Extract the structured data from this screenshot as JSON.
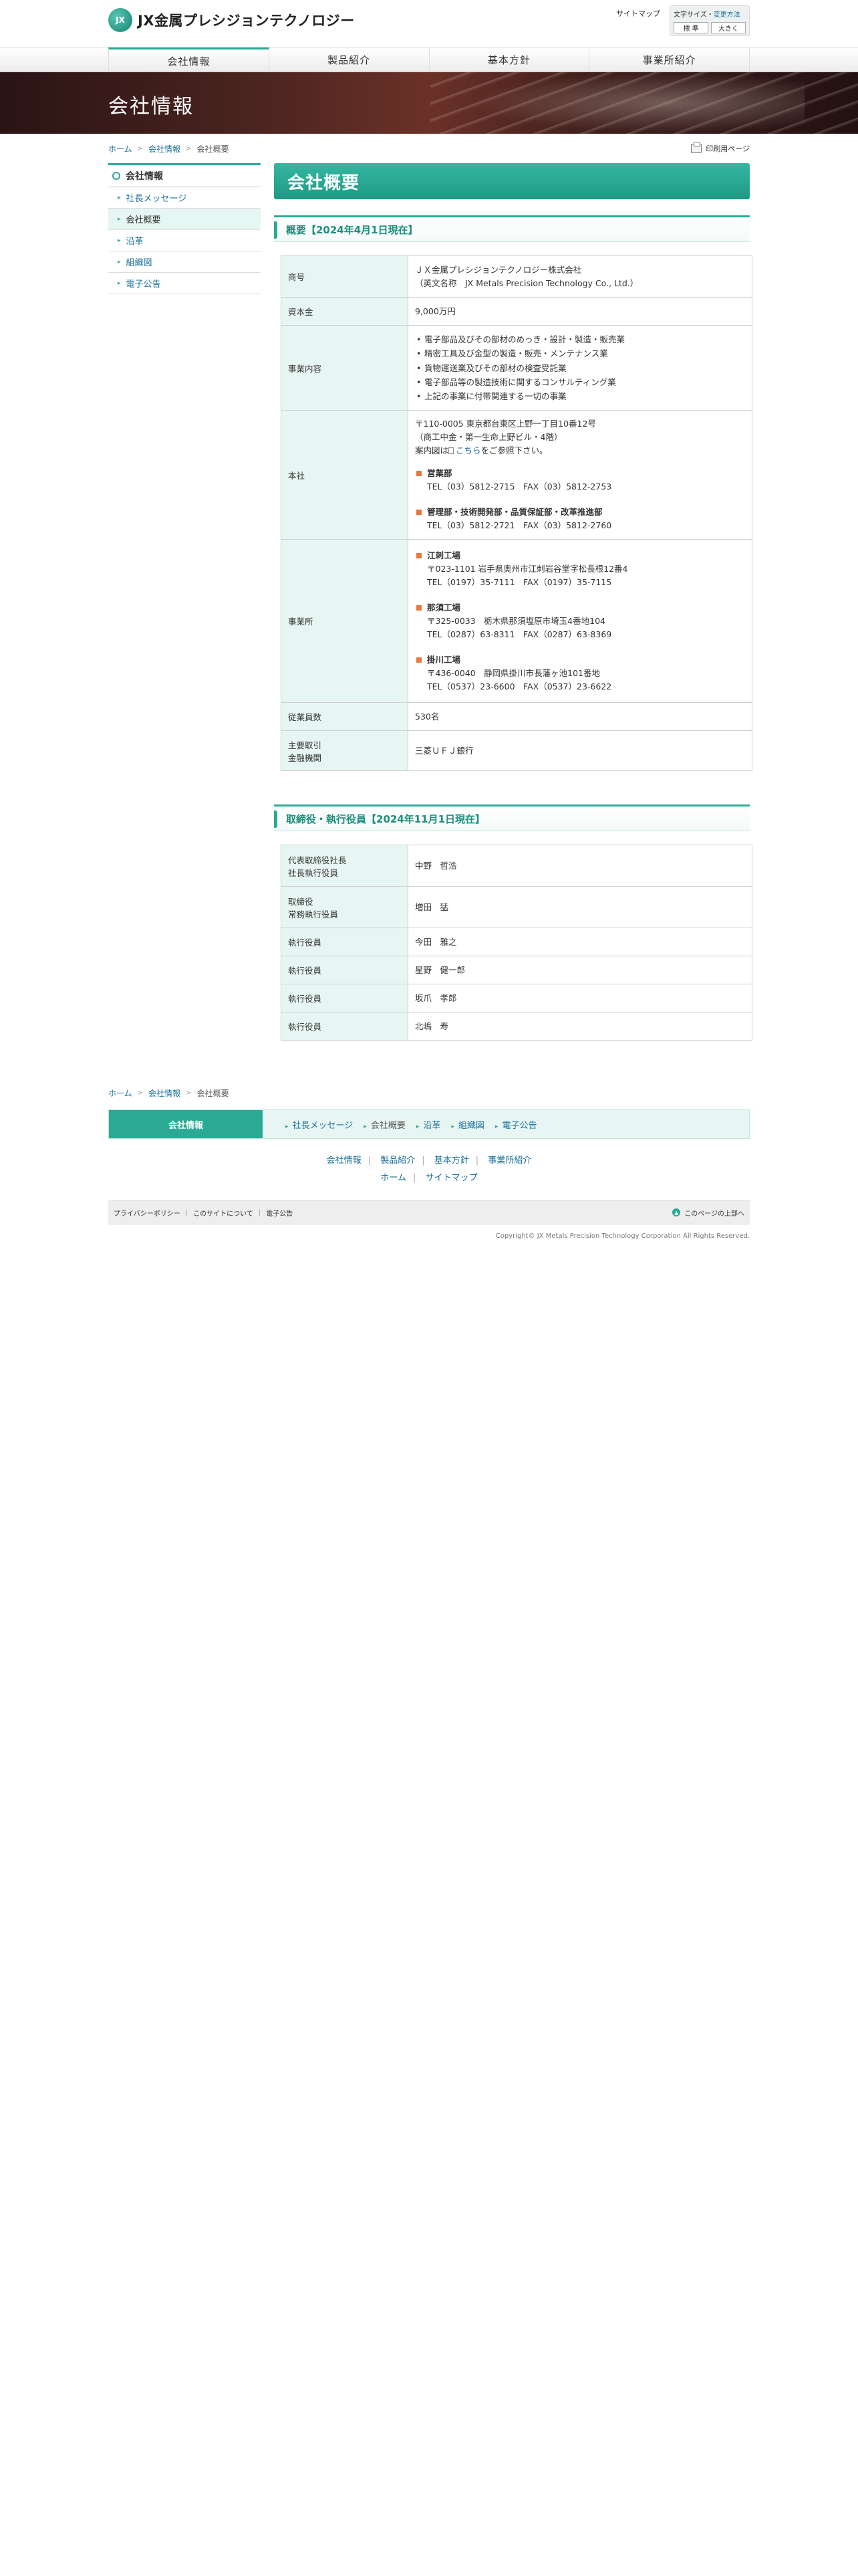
{
  "header": {
    "logo_mark": "JX",
    "logo_text": "JX金属プレシジョンテクノロジー",
    "sitemap": "サイトマップ",
    "fontsize_label": "文字サイズ・",
    "fontsize_change": "変更方法",
    "fontsize_normal": "標 準",
    "fontsize_large": "大きく"
  },
  "gnav": [
    "会社情報",
    "製品紹介",
    "基本方針",
    "事業所紹介"
  ],
  "hero": {
    "title": "会社情報"
  },
  "breadcrumb": {
    "home": "ホーム",
    "section": "会社情報",
    "current": "会社概要",
    "print": "印刷用ページ"
  },
  "sidebar": {
    "heading": "会社情報",
    "items": [
      {
        "label": "社長メッセージ"
      },
      {
        "label": "会社概要"
      },
      {
        "label": "沿革"
      },
      {
        "label": "組織図"
      },
      {
        "label": "電子公告"
      }
    ]
  },
  "main": {
    "title": "会社概要",
    "overview_heading": "概要【2024年4月1日現在】",
    "overview": {
      "name_label": "商号",
      "name_line1": "ＪＸ金属プレシジョンテクノロジー株式会社",
      "name_line2": "（英文名称　JX Metals Precision Technology Co., Ltd.）",
      "capital_label": "資本金",
      "capital": "9,000万円",
      "business_label": "事業内容",
      "business": [
        "電子部品及びその部材のめっき・設計・製造・販売業",
        "精密工具及び金型の製造・販売・メンテナンス業",
        "貨物運送業及びその部材の検査受託業",
        "電子部品等の製造技術に関するコンサルティング業",
        "上記の事業に付帯関連する一切の事業"
      ],
      "hq_label": "本社",
      "hq_line1": "〒110-0005 東京都台東区上野一丁目10番12号",
      "hq_line2": "（商工中金・第一生命上野ビル・4階）",
      "hq_map_pre": "案内図は",
      "hq_map_link": "こちら",
      "hq_map_post": "をご参照下さい。",
      "hq_offices": [
        {
          "name": "営業部",
          "tel": "TEL（03）5812-2715　FAX（03）5812-2753"
        },
        {
          "name": "管理部・技術開発部・品質保証部・改革推進部",
          "tel": "TEL（03）5812-2721　FAX（03）5812-2760"
        }
      ],
      "plants_label": "事業所",
      "plants": [
        {
          "name": "江刺工場",
          "addr": "〒023-1101 岩手県奥州市江刺岩谷堂字松長根12番4",
          "tel": "TEL（0197）35-7111　FAX（0197）35-7115"
        },
        {
          "name": "那須工場",
          "addr": "〒325-0033　栃木県那須塩原市埼玉4番地104",
          "tel": "TEL（0287）63-8311　FAX（0287）63-8369"
        },
        {
          "name": "掛川工場",
          "addr": "〒436-0040　静岡県掛川市長藩ヶ池101番地",
          "tel": "TEL（0537）23-6600　FAX（0537）23-6622"
        }
      ],
      "employees_label": "従業員数",
      "employees": "530名",
      "bank_label_1": "主要取引",
      "bank_label_2": "金融機関",
      "bank": "三菱ＵＦＪ銀行"
    },
    "officers_heading": "取締役・執行役員【2024年11月1日現在】",
    "officers": [
      {
        "role_1": "代表取締役社長",
        "role_2": "社長執行役員",
        "name": "中野　哲浩"
      },
      {
        "role_1": "取締役",
        "role_2": "常務執行役員",
        "name": "増田　猛"
      },
      {
        "role_1": "執行役員",
        "role_2": "",
        "name": "今田　雅之"
      },
      {
        "role_1": "執行役員",
        "role_2": "",
        "name": "星野　健一郎"
      },
      {
        "role_1": "執行役員",
        "role_2": "",
        "name": "坂爪　孝郎"
      },
      {
        "role_1": "執行役員",
        "role_2": "",
        "name": "北嶋　寿"
      }
    ]
  },
  "footer": {
    "local_head": "会社情報",
    "local_links": [
      "社長メッセージ",
      "会社概要",
      "沿革",
      "組織図",
      "電子公告"
    ],
    "links_row1": [
      "会社情報",
      "製品紹介",
      "基本方針",
      "事業所紹介"
    ],
    "links_row2": [
      "ホーム",
      "サイトマップ"
    ],
    "bar_links": [
      "プライバシーポリシー",
      "このサイトについて",
      "電子公告"
    ],
    "pagetop": "このページの上部へ",
    "copyright": "Copyright© JX Metals Precision Technology Corporation All Rights Reserved."
  },
  "colors": {
    "accent": "#2aaa95",
    "table_head_bg": "#e8f6f3",
    "bullet": "#e9793a"
  }
}
